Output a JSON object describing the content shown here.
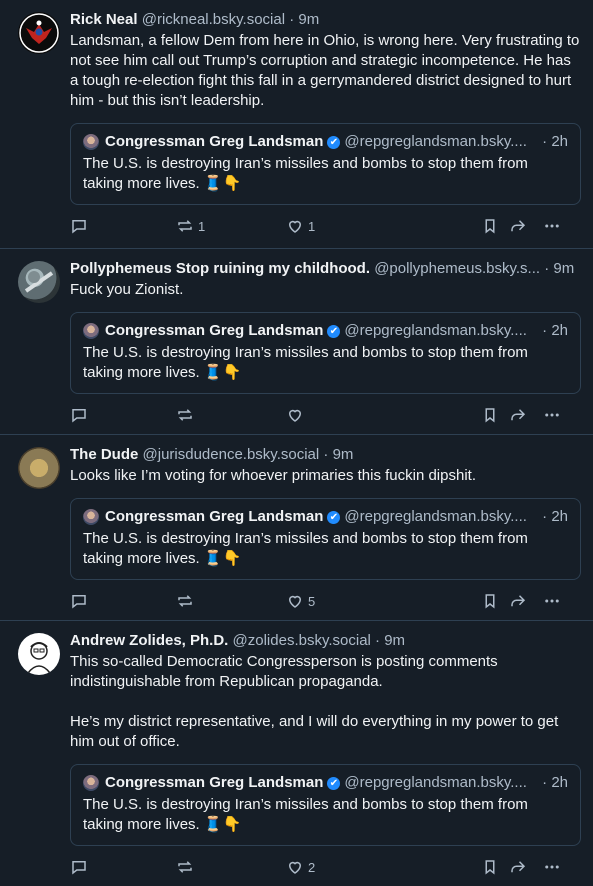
{
  "posts": [
    {
      "name": "Rick Neal",
      "handle": "@rickneal.bsky.social",
      "dot": "·",
      "time": "9m",
      "text": "Landsman, a fellow Dem from here in Ohio, is wrong here. Very frustrating to not see him call out Trump’s corruption and strategic incompetence. He has a tough re-election fight this fall in a gerrymandered district designed to hurt him - but this isn’t leadership.",
      "repost_count": "1",
      "like_count": "1",
      "avatar_colors": [
        "#0b0b0b",
        "#c0241e",
        "#1e4fa8"
      ]
    },
    {
      "name": "Pollyphemeus Stop ruining my childhood.",
      "handle": "@pollyphemeus.bsky.s...",
      "dot": "·",
      "time": "9m",
      "text": "Fuck you Zionist.",
      "repost_count": "",
      "like_count": "",
      "avatar_colors": [
        "#5f6d72",
        "#a7b8bc",
        "#2c3437"
      ]
    },
    {
      "name": "The Dude",
      "handle": "@jurisdudence.bsky.social",
      "dot": "·",
      "time": "9m",
      "text": "Looks like I’m voting for whoever primaries this fuckin dipshit.",
      "repost_count": "",
      "like_count": "5",
      "avatar_colors": [
        "#8a7a55",
        "#c9ad6a",
        "#4a3f2c"
      ]
    },
    {
      "name": "Andrew Zolides, Ph.D.",
      "handle": "@zolides.bsky.social",
      "dot": "·",
      "time": "9m",
      "text": "This so-called Democratic Congressperson is posting comments indistinguishable from Republican propaganda.\n\nHe’s my district representative, and I will do everything in my power to get him out of office.",
      "repost_count": "",
      "like_count": "2",
      "avatar_colors": [
        "#ffffff",
        "#222222",
        "#888888"
      ]
    }
  ],
  "quote": {
    "name": "Congressman Greg Landsman",
    "verified_icon": "✔",
    "handle": "@repgreglandsman.bsky....",
    "dot": "·",
    "time": "2h",
    "text": "The U.S. is destroying Iran’s missiles and bombs to stop them from taking more lives. 🧵👇"
  },
  "colors": {
    "background": "#161e27",
    "border": "#2e4052",
    "muted": "#aebbc9",
    "verified": "#208bfe"
  }
}
